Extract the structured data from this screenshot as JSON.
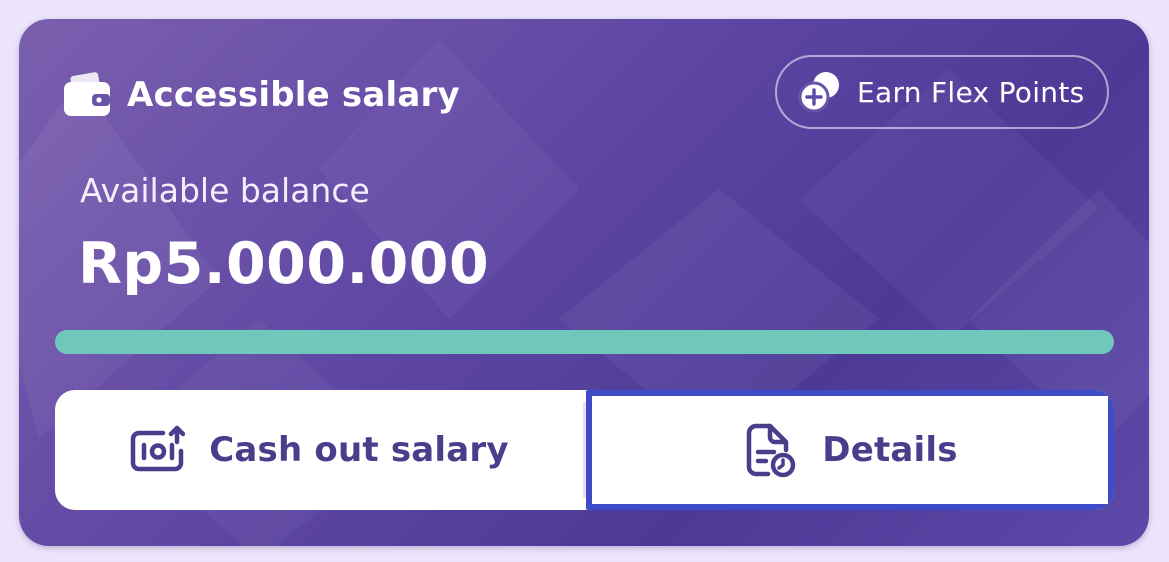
{
  "card": {
    "title": "Accessible salary",
    "title_icon": "wallet-icon",
    "earn_button_label": "Earn Flex Points",
    "earn_button_icon": "coins-plus-icon"
  },
  "balance": {
    "label": "Available balance",
    "value": "Rp5.000.000"
  },
  "progress": {
    "fill_fraction": 1.0,
    "fill_color": "#70c7bc"
  },
  "actions": {
    "cashout_label": "Cash out salary",
    "cashout_icon": "cash-out-icon",
    "details_label": "Details",
    "details_icon": "document-clock-icon"
  },
  "colors": {
    "card_accent": "#5f47a4",
    "action_text": "#4c3d8c",
    "highlight_border": "#3d4bc8"
  }
}
